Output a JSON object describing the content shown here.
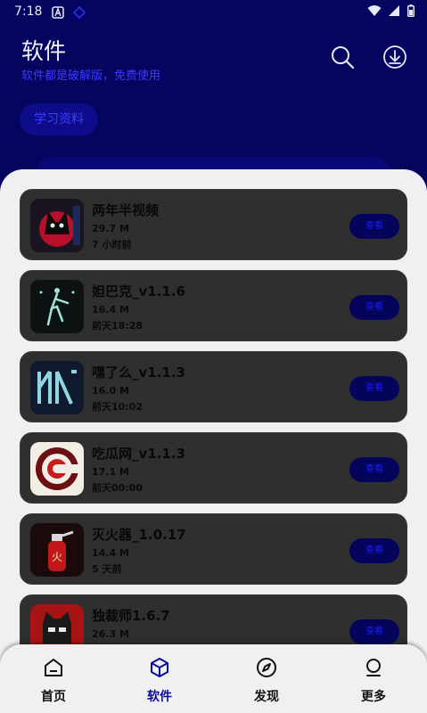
{
  "status_bar": {
    "time": "7:18"
  },
  "header": {
    "title": "软件",
    "subtitle": "软件都是破解版，免费使用"
  },
  "tabs": [
    {
      "label": "学习资料",
      "active": true
    },
    {
      "label": "",
      "active": false
    },
    {
      "label": "",
      "active": false
    }
  ],
  "apps": [
    {
      "name": "两年半视频",
      "size": "29.7 M",
      "date": "7 小时前",
      "button": "查看",
      "icon": "black-cat-icon"
    },
    {
      "name": "妲巴克_v1.1.6",
      "size": "16.4 M",
      "date": "前天18:28",
      "button": "查看",
      "icon": "figure-icon"
    },
    {
      "name": "嘿了么_v1.1.3",
      "size": "16.0 M",
      "date": "前天10:02",
      "button": "查看",
      "icon": "hl-logo-icon"
    },
    {
      "name": "吃瓜网_v1.1.3",
      "size": "17.1 M",
      "date": "前天00:00",
      "button": "查看",
      "icon": "c-ring-icon"
    },
    {
      "name": "灭火器_1.0.17",
      "size": "14.4 M",
      "date": "5 天前",
      "button": "查看",
      "icon": "extinguisher-icon"
    },
    {
      "name": "独裁师1.6.7",
      "size": "26.3 M",
      "date": "",
      "button": "查看",
      "icon": "red-face-icon"
    }
  ],
  "nav": [
    {
      "label": "首页",
      "icon": "home-icon",
      "active": false
    },
    {
      "label": "软件",
      "icon": "cube-icon",
      "active": true
    },
    {
      "label": "发现",
      "icon": "compass-icon",
      "active": false
    },
    {
      "label": "更多",
      "icon": "person-icon",
      "active": false
    }
  ],
  "colors": {
    "header_bg": "#05045e",
    "accent": "#0a0a9a",
    "sheet_bg": "#f0f0f2",
    "card_bg": "#2f2f2f",
    "button_bg": "#04045a"
  }
}
